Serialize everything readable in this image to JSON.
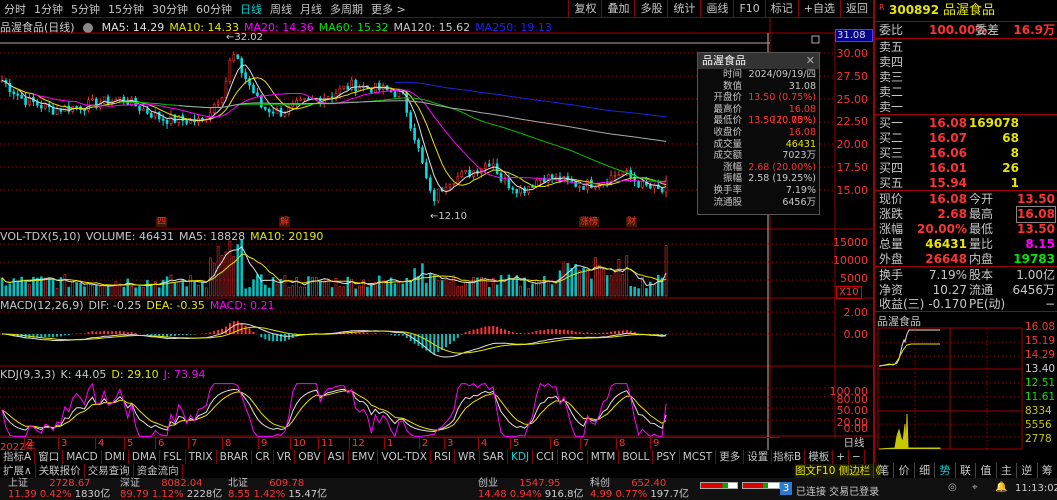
{
  "toolbar": {
    "period_tabs": [
      "分时",
      "1分钟",
      "5分钟",
      "15分钟",
      "30分钟",
      "60分钟",
      "日线",
      "周线",
      "月线",
      "多周期",
      "更多 >"
    ],
    "active_tab": "日线",
    "right_buttons": [
      "复权",
      "叠加",
      "多股",
      "统计",
      "画线",
      "F10",
      "标记",
      "+自选",
      "返回"
    ]
  },
  "main_chart": {
    "title": "品渥食品(日线)",
    "ma": [
      {
        "label": "MA5: 14.29",
        "color": "#e0e0e0"
      },
      {
        "label": "MA10: 14.33",
        "color": "#e6e600"
      },
      {
        "label": "MA20: 14.36",
        "color": "#ff00ff"
      },
      {
        "label": "MA60: 15.32",
        "color": "#00e600"
      },
      {
        "label": "MA120: 15.62",
        "color": "#c8c8c8"
      },
      {
        "label": "MA250: 19.13",
        "color": "#2020ff"
      }
    ],
    "high_label": "32.02",
    "low_label": "12.10",
    "current_value": "31.08",
    "price_ticks": [
      "30.00",
      "27.50",
      "25.00",
      "22.50",
      "20.00",
      "17.50",
      "15.00"
    ],
    "event_markers": [
      "四",
      "解",
      "涨榜",
      "财"
    ]
  },
  "tooltip": {
    "title": "品渥食品",
    "rows": [
      {
        "k": "时间",
        "v": "2024/09/19/四",
        "c": "#c8c8c8"
      },
      {
        "k": "数值",
        "v": "31.08",
        "c": "#c8c8c8"
      },
      {
        "k": "开盘价",
        "v": "13.50 (0.75%)",
        "c": "#ff3232"
      },
      {
        "k": "最高价",
        "v": "16.08 (20.00%)",
        "c": "#ff3232"
      },
      {
        "k": "最低价",
        "v": "13.50 (0.75%)",
        "c": "#ff3232"
      },
      {
        "k": "收盘价",
        "v": "16.08",
        "c": "#ff3232"
      },
      {
        "k": "成交量",
        "v": "46431",
        "c": "#e6e600"
      },
      {
        "k": "成交额",
        "v": "7023万",
        "c": "#c8c8c8"
      },
      {
        "k": "涨幅",
        "v": "2.68 (20.00%)",
        "c": "#ff3232"
      },
      {
        "k": "振幅",
        "v": "2.58 (19.25%)",
        "c": "#c8c8c8"
      },
      {
        "k": "换手率",
        "v": "7.19%",
        "c": "#c8c8c8"
      },
      {
        "k": "流通股",
        "v": "6456万",
        "c": "#c8c8c8"
      }
    ]
  },
  "volume": {
    "name": "VOL-TDX(5,10)",
    "volume": "VOLUME: 46431",
    "ma5": "MA5: 18828",
    "ma10": "MA10: 20190",
    "ticks": [
      "15000",
      "10000",
      "5000"
    ],
    "unit": "X10"
  },
  "macd": {
    "name": "MACD(12,26,9)",
    "dif": "DIF: -0.25",
    "dea": "DEA: -0.35",
    "macd": "MACD: 0.21",
    "ticks": [
      "2.00",
      "0.00"
    ]
  },
  "kdj": {
    "name": "KDJ(9,3,3)",
    "k": "K: 44.05",
    "d": "D: 29.10",
    "j": "J: 73.94",
    "ticks": [
      "100.00",
      "80.00",
      "50.00",
      "20.00",
      "0.00"
    ]
  },
  "date_axis": [
    "2022年",
    "2",
    "3",
    "4",
    "5",
    "6",
    "7",
    "8",
    "9",
    "10",
    "11",
    "12",
    "1",
    "2",
    "3",
    "4",
    "5",
    "6",
    "7",
    "8",
    "9"
  ],
  "period_label": "日线",
  "indicator_tabs": [
    "指标A",
    "窗口",
    "MACD",
    "DMI",
    "DMA",
    "FSL",
    "TRIX",
    "BRAR",
    "CR",
    "VR",
    "OBV",
    "ASI",
    "EMV",
    "VOL-TDX",
    "RSI",
    "WR",
    "SAR",
    "KDJ",
    "CCI",
    "ROC",
    "MTM",
    "BOLL",
    "PSY",
    "MCST",
    "更多",
    "设置"
  ],
  "active_indicator": "KDJ",
  "indicator_right": [
    "指标B",
    "模板",
    "+",
    "−"
  ],
  "ext_tabs": [
    "扩展∧",
    "关联报价",
    "交易查询",
    "资金流向"
  ],
  "right_panel": {
    "code": "300892",
    "name": "品渥食品",
    "weibi_label": "委比",
    "weibi": "100.00%",
    "weicha_label": "委差",
    "weicha": "16.9万",
    "sell": [
      "卖五",
      "卖四",
      "卖三",
      "卖二",
      "卖一"
    ],
    "buy": [
      {
        "l": "买一",
        "p": "16.08",
        "v": "169078"
      },
      {
        "l": "买二",
        "p": "16.07",
        "v": "68"
      },
      {
        "l": "买三",
        "p": "16.06",
        "v": "8"
      },
      {
        "l": "买四",
        "p": "16.01",
        "v": "26"
      },
      {
        "l": "买五",
        "p": "15.94",
        "v": "1"
      }
    ],
    "quote": [
      {
        "l1": "现价",
        "v1": "16.08",
        "c1": "#ff3232",
        "l2": "今开",
        "v2": "13.50",
        "c2": "#ff3232"
      },
      {
        "l1": "涨跌",
        "v1": "2.68",
        "c1": "#ff3232",
        "l2": "最高",
        "v2": "16.08",
        "c2": "#ff3232"
      },
      {
        "l1": "涨幅",
        "v1": "20.00%",
        "c1": "#ff3232",
        "l2": "最低",
        "v2": "13.50",
        "c2": "#ff3232"
      },
      {
        "l1": "总量",
        "v1": "46431",
        "c1": "#e6e600",
        "l2": "量比",
        "v2": "8.15",
        "c2": "#ff00ff"
      },
      {
        "l1": "外盘",
        "v1": "26648",
        "c1": "#ff3232",
        "l2": "内盘",
        "v2": "19783",
        "c2": "#00e600"
      }
    ],
    "fund": [
      {
        "l1": "换手",
        "v1": "7.19%",
        "l2": "股本",
        "v2": "1.00亿"
      },
      {
        "l1": "净资",
        "v1": "10.27",
        "l2": "流通",
        "v2": "6456万"
      },
      {
        "l1": "收益(三)",
        "v1": "-0.170",
        "l2": "PE(动)",
        "v2": "−"
      }
    ],
    "mini_title": "品渥食品",
    "mini_prices": [
      {
        "v": "16.08",
        "c": "#ff3232"
      },
      {
        "v": "15.19",
        "c": "#ff3232"
      },
      {
        "v": "14.29",
        "c": "#ff3232"
      },
      {
        "v": "13.40",
        "c": "#d0d0d0"
      },
      {
        "v": "12.51",
        "c": "#00e600"
      },
      {
        "v": "11.61",
        "c": "#00e600"
      }
    ],
    "mini_vols": [
      "8334",
      "5556",
      "2778"
    ]
  },
  "right_tabs": [
    "笔",
    "价",
    "细",
    "势",
    "联",
    "值",
    "主",
    "逆",
    "筹"
  ],
  "f10_label": "图文F10",
  "sidebar_label": "侧边栏《",
  "status": {
    "indices": [
      {
        "n": "上证",
        "v": "2728.67",
        "chg": "11.39",
        "pct": "0.42%",
        "amt": "1830亿"
      },
      {
        "n": "深证",
        "v": "8082.04",
        "chg": "89.79",
        "pct": "1.12%",
        "amt": "2228亿"
      },
      {
        "n": "北证",
        "v": "609.78",
        "chg": "8.55",
        "pct": "1.42%",
        "amt": "15.47亿"
      },
      {
        "n": "创业",
        "v": "1547.95",
        "chg": "14.48",
        "pct": "0.94%",
        "amt": "916.8亿"
      },
      {
        "n": "科创",
        "v": "652.40",
        "chg": "4.99",
        "pct": "0.77%",
        "amt": "197.7亿"
      }
    ],
    "badge": "3",
    "conn": "已连接 交易已登录",
    "time": "11:13:02"
  }
}
